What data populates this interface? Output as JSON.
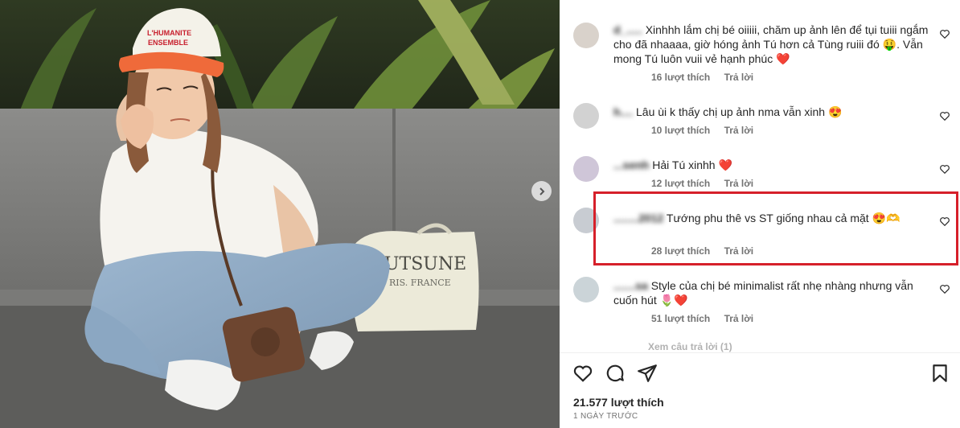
{
  "post": {
    "likes_label": "21.577 lượt thích",
    "time_label": "1 NGÀY TRƯỚC"
  },
  "comments": [
    {
      "username": "d_.....",
      "text": "Xinhhh lắm chị bé oiiiii, chăm up ảnh lên để tụi tuiii ngắm cho đã nhaaaa, giờ hóng ảnh Tú hơn cả Tùng ruiii đó 🤑. Vẫn mong Tú luôn vuii vẻ hạnh phúc ❤️",
      "likes": "16 lượt thích",
      "reply": "Trả lời"
    },
    {
      "username": "h....",
      "text": "Lâu ùi k thấy chị up ảnh nma vẫn xinh 😍",
      "likes": "10 lượt thích",
      "reply": "Trả lời"
    },
    {
      "username": "...senh",
      "text": "Hải Tú xinhh ❤️",
      "likes": "12 lượt thích",
      "reply": "Trả lời"
    },
    {
      "username": "........2012",
      "text": "Tướng phu thê vs ST giống nhau cả mặt 😍🫶",
      "likes": "28 lượt thích",
      "reply": "Trả lời"
    },
    {
      "username": ".......sa",
      "text": "Style của chị bé minimalist rất nhẹ nhàng nhưng vẫn cuốn hút 🌷❤️",
      "likes": "51 lượt thích",
      "reply": "Trả lời"
    }
  ],
  "view_replies": "Xem câu trả lời (1)",
  "icons": {
    "like": "heart-icon",
    "comment": "comment-icon",
    "share": "share-icon",
    "save": "bookmark-icon",
    "next": "chevron-right-icon"
  },
  "colors": {
    "highlight": "#d6202a",
    "text": "#262626",
    "meta": "#737373",
    "heart_red": "#ed2939"
  }
}
